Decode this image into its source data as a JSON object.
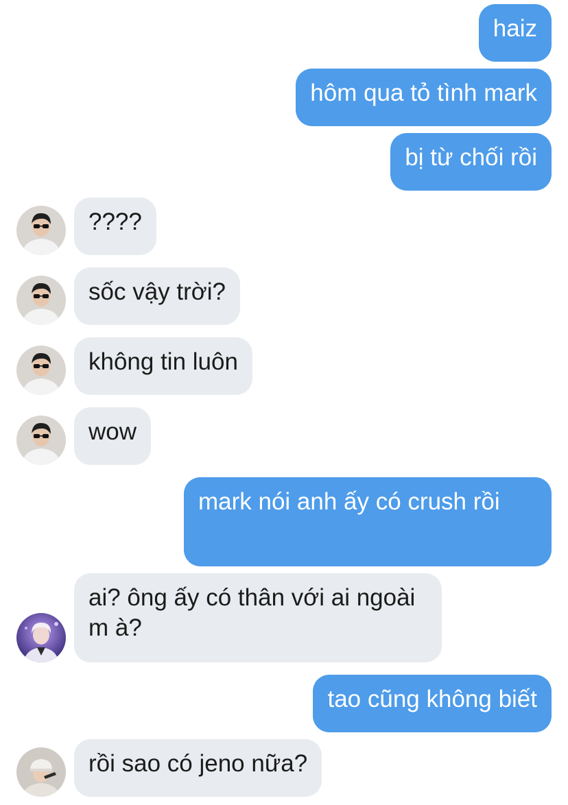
{
  "conversation": {
    "messages": [
      {
        "id": 0,
        "side": "out",
        "text": "haiz"
      },
      {
        "id": 1,
        "side": "out",
        "text": "hôm qua tỏ tình mark"
      },
      {
        "id": 2,
        "side": "out",
        "text": "bị từ chối rồi"
      },
      {
        "id": 3,
        "side": "in",
        "avatar": "person-sunglasses-avatar",
        "text": "????"
      },
      {
        "id": 4,
        "side": "in",
        "avatar": "person-sunglasses-avatar",
        "text": "sốc vậy trời?"
      },
      {
        "id": 5,
        "side": "in",
        "avatar": "person-sunglasses-avatar",
        "text": "không tin luôn"
      },
      {
        "id": 6,
        "side": "in",
        "avatar": "person-sunglasses-avatar",
        "text": "wow"
      },
      {
        "id": 7,
        "side": "out",
        "text": "mark nói anh ấy có crush rồi"
      },
      {
        "id": 8,
        "side": "in",
        "avatar": "person-purple-light-avatar",
        "text": "ai? ông ấy có thân với ai ngoài m à?"
      },
      {
        "id": 9,
        "side": "out",
        "text": "tao cũng không biết"
      },
      {
        "id": 10,
        "side": "in",
        "avatar": "person-cap-avatar",
        "text": "rồi sao có jeno nữa?"
      }
    ]
  },
  "colors": {
    "outgoing_bubble": "#4e9cea",
    "incoming_bubble": "#e8ebef",
    "outgoing_text": "#ffffff",
    "incoming_text": "#1b1b1b"
  }
}
